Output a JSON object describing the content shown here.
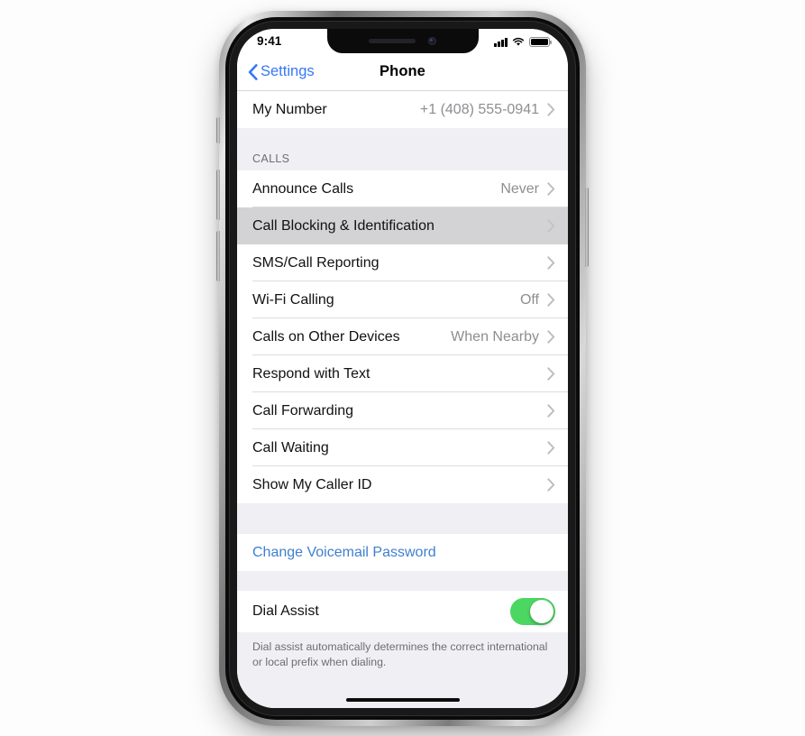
{
  "status_bar": {
    "time": "9:41",
    "signal_icon": "cellular-signal-icon",
    "wifi_icon": "wifi-icon",
    "battery_icon": "battery-full-icon"
  },
  "nav": {
    "back_label": "Settings",
    "back_icon": "chevron-left-icon",
    "title": "Phone"
  },
  "sections": {
    "my_number": {
      "label": "My Number",
      "value": "+1 (408) 555-0941"
    },
    "calls_header": "CALLS",
    "calls_rows": [
      {
        "label": "Announce Calls",
        "value": "Never"
      },
      {
        "label": "Call Blocking & Identification",
        "value": ""
      },
      {
        "label": "SMS/Call Reporting",
        "value": ""
      },
      {
        "label": "Wi-Fi Calling",
        "value": "Off"
      },
      {
        "label": "Calls on Other Devices",
        "value": "When Nearby"
      },
      {
        "label": "Respond with Text",
        "value": ""
      },
      {
        "label": "Call Forwarding",
        "value": ""
      },
      {
        "label": "Call Waiting",
        "value": ""
      },
      {
        "label": "Show My Caller ID",
        "value": ""
      }
    ],
    "voicemail": {
      "label": "Change Voicemail Password"
    },
    "dial_assist": {
      "label": "Dial Assist",
      "state": "on"
    },
    "footer_note": "Dial assist automatically determines the correct international or local prefix when dialing."
  },
  "colors": {
    "accent_blue": "#3478f6",
    "link_blue": "#3f7fcf",
    "toggle_green": "#4cd763",
    "group_bg": "#efeff4",
    "row_bg": "#ffffff",
    "pressed_row_bg": "#d3d3d6",
    "value_gray": "#8e8e93",
    "separator": "#dcdce0"
  }
}
